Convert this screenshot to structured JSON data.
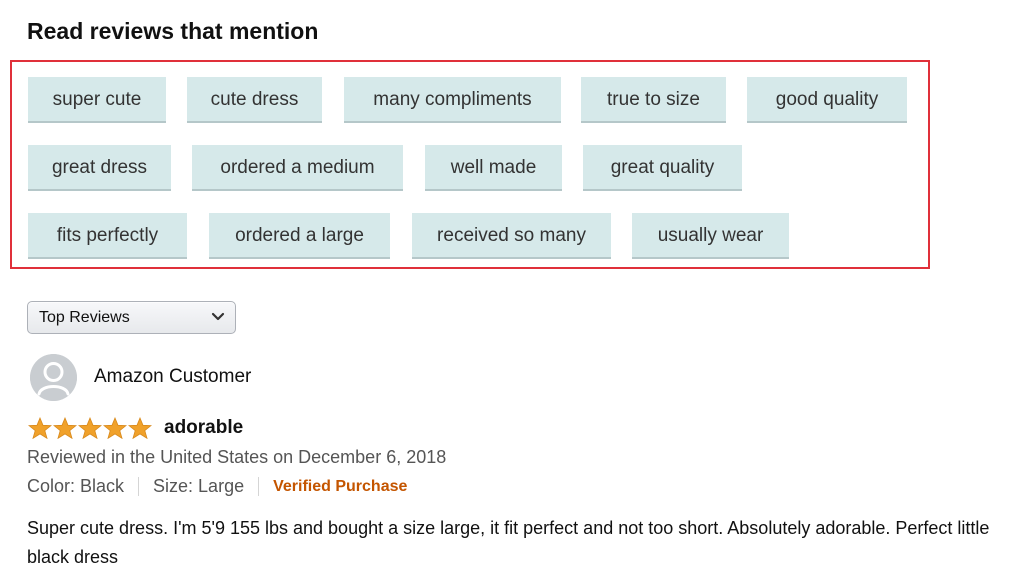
{
  "mentions": {
    "title": "Read reviews that mention",
    "chips": [
      "super cute",
      "cute dress",
      "many compliments",
      "true to size",
      "good quality",
      "great dress",
      "ordered a medium",
      "well made",
      "great quality",
      "fits perfectly",
      "ordered a large",
      "received so many",
      "usually wear"
    ]
  },
  "sort": {
    "selected": "Top Reviews",
    "icon": "chevron-down-icon"
  },
  "review": {
    "reviewer": "Amazon Customer",
    "avatar_icon": "user-avatar-icon",
    "rating": 5,
    "rating_max": 5,
    "title": "adorable",
    "date_line": "Reviewed in the United States on December 6, 2018",
    "color": "Color: Black",
    "size": "Size: Large",
    "verified": "Verified Purchase",
    "body": "Super cute dress. I'm 5'9 155 lbs and bought a size large, it fit perfect and not too short. Absolutely adorable. Perfect little black dress"
  },
  "colors": {
    "chip_bg": "#d6e9ea",
    "highlight_border": "#e0303a",
    "star": "#f0a12a",
    "verified": "#c45500"
  }
}
